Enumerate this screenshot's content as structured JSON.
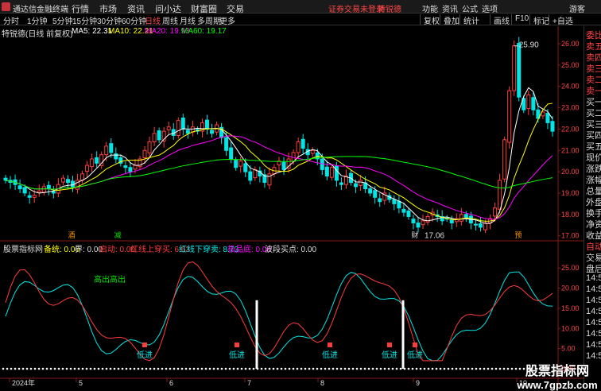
{
  "titlebar": {
    "app_name": "通达信金融终端",
    "menus": [
      "行情",
      "市场",
      "资讯",
      "问小达",
      "财富圈",
      "交易"
    ],
    "warning": "证券交易未登录",
    "stock": "特锐德",
    "tools": [
      "功能",
      "资讯",
      "公式",
      "选项"
    ],
    "guest": "游客"
  },
  "periods": [
    "分时",
    "1分钟",
    "5分钟",
    "15分钟",
    "30分钟",
    "60分钟",
    "日线",
    "周线",
    "月线",
    "多周期",
    "更多"
  ],
  "active_period": "日线",
  "toolbuttons": [
    "复权",
    "叠加",
    "统计",
    "画线",
    "F10",
    "标记",
    "+自选"
  ],
  "info": {
    "name": "特锐德(日线 前复权)",
    "ma5": "MA5: 22.31",
    "ma10": "MA10: 22.21",
    "ma20": "MA20: 19.93",
    "ma60": "MA60: 19.17"
  },
  "right_panel": [
    "委比",
    "卖五",
    "卖四",
    "卖三",
    "卖二",
    "卖一",
    "买一",
    "买二",
    "买三",
    "买四",
    "买五",
    "现价",
    "涨跌",
    "涨幅",
    "总量",
    "外盘",
    "换手",
    "净资",
    "收益",
    "自动",
    "交易",
    "盘后",
    "14:5",
    "14:5",
    "14:5",
    "14:5",
    "14:5",
    "14:5",
    "14:5",
    "14:5"
  ],
  "markers": {
    "m1": "酒",
    "m2": "减",
    "m3": "财",
    "m4": "预"
  },
  "indicator": {
    "title": "股票指标网",
    "a": "备统: 0.00",
    "b": "界: 0.00",
    "c": "启动: 0.00",
    "d": "红线上穿买: 6.63",
    "e": "红线下穿卖: 8.73",
    "f": "极品底: 0.00",
    "g": "波段买点: 0.00"
  },
  "signals": {
    "gaochu": "高出",
    "dijin": "低进"
  },
  "watermark": {
    "line1": "股票指标网",
    "line2": "www.7gpzb.com"
  },
  "colors": {
    "up": "#ff3c3c",
    "down": "#00e6e6",
    "ma5": "#ffffff",
    "ma10": "#ffff00",
    "ma20": "#ff00ff",
    "ma60": "#00ff00"
  },
  "chart_data": [
    {
      "type": "candlestick",
      "title": "特锐德(日线 前复权)",
      "ylim": [
        16.8,
        26.3
      ],
      "yticks": [
        "26.00",
        "25.00",
        "24.00",
        "23.00",
        "22.00",
        "21.00",
        "20.00",
        "19.00",
        "18.00",
        "17.00"
      ],
      "annotations": [
        {
          "label": "25.90"
        },
        {
          "label": "17.06"
        }
      ],
      "x_labels": [
        "2024年",
        "5",
        "6",
        "7",
        "8",
        "9",
        "10"
      ],
      "closes": [
        19.6,
        19.5,
        19.4,
        19.2,
        19.0,
        18.8,
        18.9,
        19.1,
        19.3,
        19.2,
        19.0,
        19.4,
        19.7,
        19.5,
        19.3,
        19.6,
        19.9,
        20.3,
        20.6,
        20.4,
        20.8,
        21.2,
        20.9,
        20.6,
        20.4,
        20.2,
        20.0,
        20.3,
        20.6,
        21.0,
        21.4,
        21.8,
        21.5,
        21.9,
        22.1,
        21.7,
        22.4,
        22.0,
        21.8,
        22.1,
        21.9,
        22.3,
        22.0,
        21.8,
        22.2,
        21.6,
        21.0,
        20.6,
        20.2,
        20.5,
        20.0,
        19.6,
        20.1,
        19.8,
        19.5,
        19.9,
        20.2,
        20.5,
        20.1,
        20.6,
        20.9,
        21.4,
        21.1,
        20.8,
        21.0,
        20.6,
        20.1,
        19.8,
        20.2,
        19.6,
        19.4,
        19.8,
        19.5,
        19.3,
        19.6,
        19.2,
        19.0,
        18.8,
        18.6,
        19.0,
        18.7,
        18.5,
        18.3,
        18.1,
        17.9,
        17.6,
        17.4,
        17.7,
        17.9,
        18.1,
        17.9,
        17.7,
        17.8,
        17.6,
        17.8,
        18.0,
        17.8,
        17.6,
        17.5,
        17.4,
        17.6,
        17.8,
        18.3,
        19.6,
        21.5,
        23.8,
        25.9,
        23.5,
        22.9,
        23.6,
        22.9,
        22.5,
        22.8,
        22.3,
        21.9
      ]
    },
    {
      "type": "line",
      "title": "",
      "ylim": [
        0,
        28
      ],
      "yticks": [
        "25.00",
        "20.00",
        "15.00",
        "10.00",
        "5.00",
        "0.00"
      ],
      "x_labels": [
        "2024年",
        "5",
        "6",
        "7",
        "8",
        "9",
        "10"
      ]
    }
  ]
}
